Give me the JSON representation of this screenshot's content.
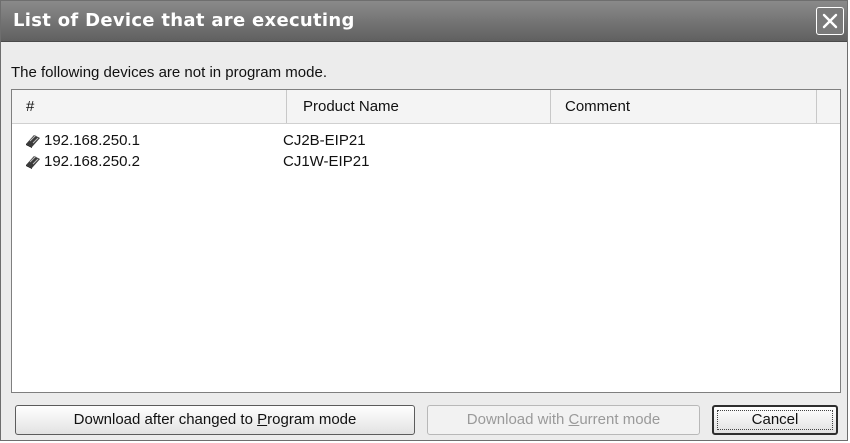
{
  "window": {
    "title": "List of Device that are executing",
    "close_icon": "close-icon"
  },
  "message": "The following devices are not in program mode.",
  "list": {
    "columns": [
      "#",
      "Product Name",
      "Comment"
    ],
    "rows": [
      {
        "icon": "device-icon",
        "address": "192.168.250.1",
        "product": "CJ2B-EIP21",
        "comment": ""
      },
      {
        "icon": "device-icon",
        "address": "192.168.250.2",
        "product": "CJ1W-EIP21",
        "comment": ""
      }
    ]
  },
  "buttons": {
    "download_program": {
      "before": "Download after changed to ",
      "accel": "P",
      "after": "rogram mode",
      "enabled": true
    },
    "download_current": {
      "before": "Download with ",
      "accel": "C",
      "after": "urrent mode",
      "enabled": false
    },
    "cancel": {
      "label": "Cancel",
      "enabled": true
    }
  },
  "colors": {
    "titlebar": "#707070",
    "title_text": "#ffffff",
    "disabled_text": "#9a9a9a"
  }
}
